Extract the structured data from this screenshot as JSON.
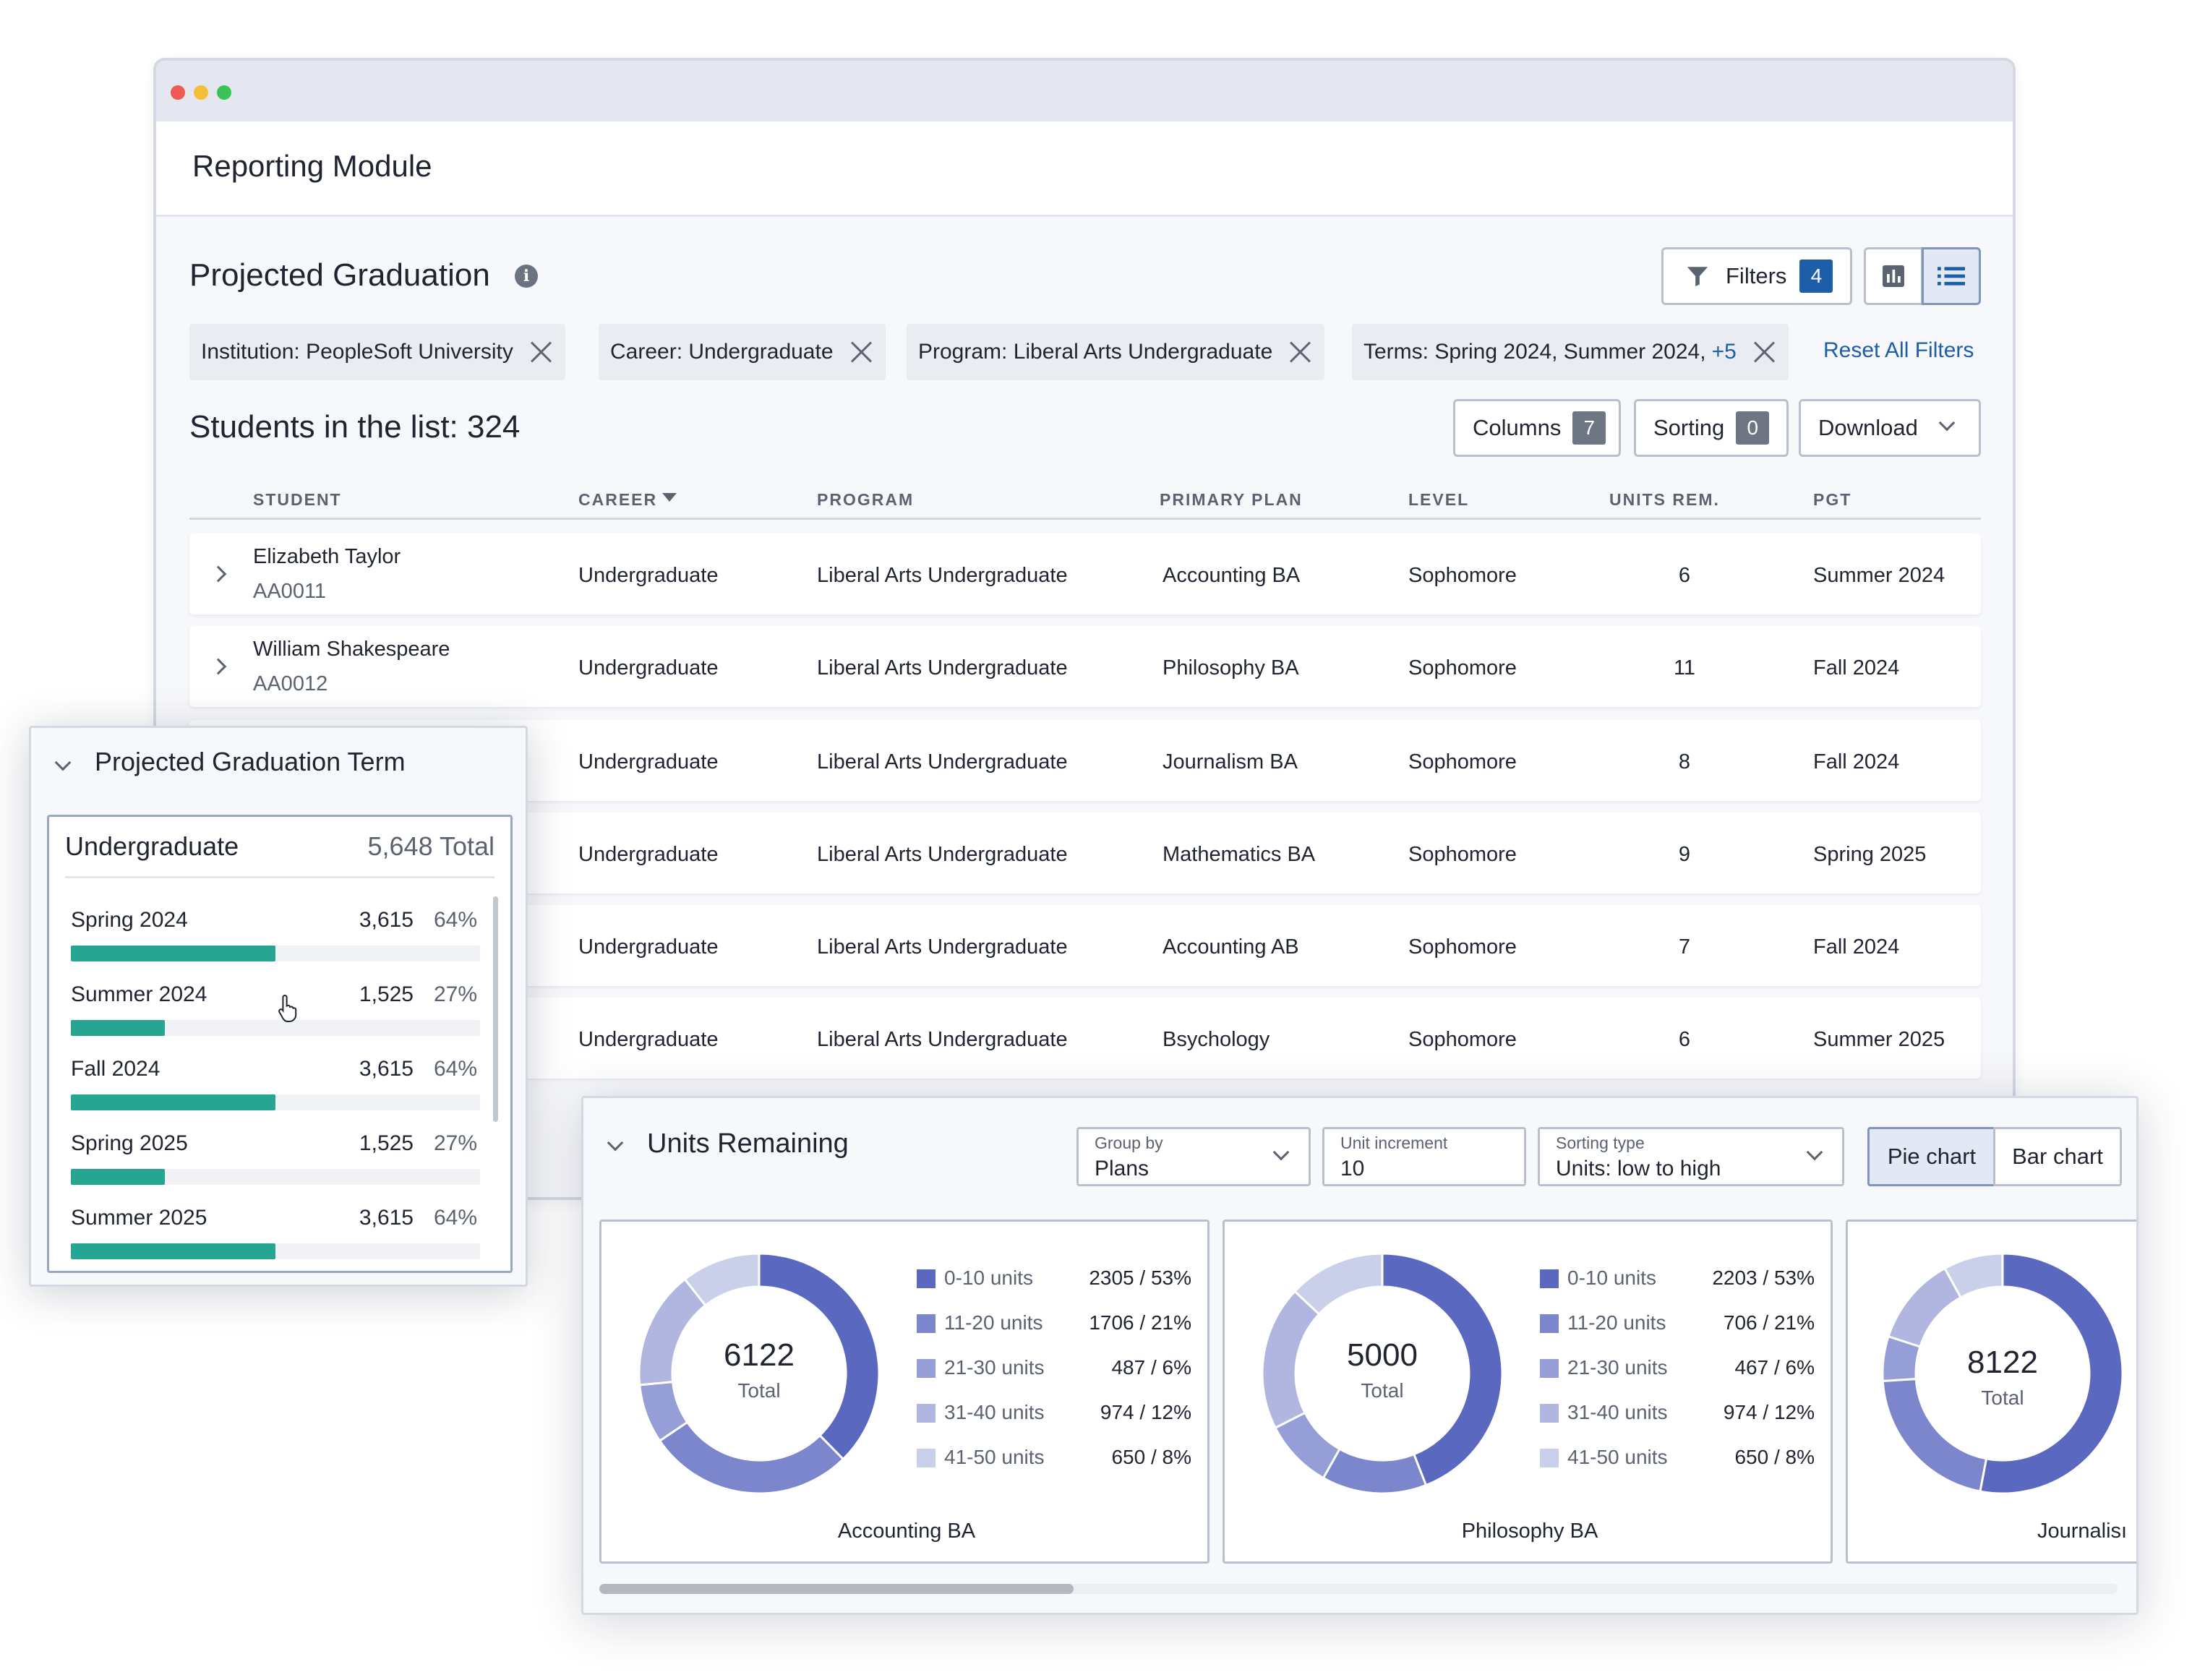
{
  "window": {
    "controls": [
      "#ec5a52",
      "#f4be3a",
      "#3bc35a"
    ],
    "module_title": "Reporting Module"
  },
  "report": {
    "title": "Projected Graduation",
    "filters_label": "Filters",
    "filters_count": "4",
    "chips": [
      {
        "text": "Institution: PeopleSoft University",
        "extra": ""
      },
      {
        "text": "Career: Undergraduate",
        "extra": ""
      },
      {
        "text": "Program: Liberal Arts Undergraduate",
        "extra": ""
      },
      {
        "text": "Terms: Spring 2024, Summer 2024,",
        "extra": "+5"
      }
    ],
    "reset_label": "Reset All Filters",
    "students_label": "Students in the list: 324",
    "columns_label": "Columns",
    "columns_count": "7",
    "sorting_label": "Sorting",
    "sorting_count": "0",
    "download_label": "Download"
  },
  "table": {
    "headers": [
      "STUDENT",
      "CAREER",
      "PROGRAM",
      "PRIMARY PLAN",
      "LEVEL",
      "UNITS REM.",
      "PGT"
    ],
    "rows": [
      {
        "name": "Elizabeth Taylor",
        "id": "AA0011",
        "career": "Undergraduate",
        "program": "Liberal Arts Undergraduate",
        "plan": "Accounting BA",
        "level": "Sophomore",
        "units": "6",
        "pgt": "Summer 2024"
      },
      {
        "name": "William Shakespeare",
        "id": "AA0012",
        "career": "Undergraduate",
        "program": "Liberal Arts Undergraduate",
        "plan": "Philosophy BA",
        "level": "Sophomore",
        "units": "11",
        "pgt": "Fall 2024"
      },
      {
        "name": "",
        "id": "",
        "career": "Undergraduate",
        "program": "Liberal Arts Undergraduate",
        "plan": "Journalism BA",
        "level": "Sophomore",
        "units": "8",
        "pgt": "Fall 2024"
      },
      {
        "name": "",
        "id": "",
        "career": "Undergraduate",
        "program": "Liberal Arts Undergraduate",
        "plan": "Mathematics BA",
        "level": "Sophomore",
        "units": "9",
        "pgt": "Spring 2025"
      },
      {
        "name": "",
        "id": "",
        "career": "Undergraduate",
        "program": "Liberal Arts Undergraduate",
        "plan": "Accounting AB",
        "level": "Sophomore",
        "units": "7",
        "pgt": "Fall 2024"
      },
      {
        "name": "",
        "id": "",
        "career": "Undergraduate",
        "program": "Liberal Arts Undergraduate",
        "plan": "Bsychology",
        "level": "Sophomore",
        "units": "6",
        "pgt": "Summer 2025"
      }
    ]
  },
  "pgt_panel": {
    "title": "Projected Graduation Term",
    "card_title": "Undergraduate",
    "card_total": "5,648 Total",
    "bar_color": "#27a593",
    "terms": [
      {
        "label": "Spring 2024",
        "count": "3,615",
        "pct": "64%",
        "fraction": 0.5
      },
      {
        "label": "Summer 2024",
        "count": "1,525",
        "pct": "27%",
        "fraction": 0.23
      },
      {
        "label": "Fall 2024",
        "count": "3,615",
        "pct": "64%",
        "fraction": 0.5
      },
      {
        "label": "Spring 2025",
        "count": "1,525",
        "pct": "27%",
        "fraction": 0.23
      },
      {
        "label": "Summer 2025",
        "count": "3,615",
        "pct": "64%",
        "fraction": 0.5
      }
    ]
  },
  "units_panel": {
    "title": "Units Remaining",
    "group_by_label": "Group by",
    "group_by_value": "Plans",
    "increment_label": "Unit increment",
    "increment_value": "10",
    "sorting_type_label": "Sorting type",
    "sorting_type_value": "Units: low to high",
    "pie_label": "Pie chart",
    "bar_label": "Bar chart"
  },
  "chart_data": [
    {
      "type": "pie",
      "title": "Accounting BA",
      "center_value": "6122",
      "center_label": "Total",
      "categories": [
        "0-10 units",
        "11-20 units",
        "21-30 units",
        "31-40 units",
        "41-50 units"
      ],
      "values": [
        2305,
        1706,
        487,
        974,
        650
      ],
      "value_labels": [
        "2305 / 53%",
        "1706 / 21%",
        "487 / 6%",
        "974 / 12%",
        "650 / 8%"
      ],
      "colors": [
        "#5b68c0",
        "#7b86cc",
        "#959ed6",
        "#b0b6e0",
        "#cacfea"
      ],
      "legend": "right"
    },
    {
      "type": "pie",
      "title": "Philosophy BA",
      "center_value": "5000",
      "center_label": "Total",
      "categories": [
        "0-10 units",
        "11-20 units",
        "21-30 units",
        "31-40 units",
        "41-50 units"
      ],
      "values": [
        2203,
        706,
        467,
        974,
        650
      ],
      "value_labels": [
        "2203 / 53%",
        "706 / 21%",
        "467 / 6%",
        "974 / 12%",
        "650 / 8%"
      ],
      "colors": [
        "#5b68c0",
        "#7b86cc",
        "#959ed6",
        "#b0b6e0",
        "#cacfea"
      ],
      "legend": "right"
    },
    {
      "type": "pie",
      "title": "Journalisı",
      "center_value": "8122",
      "center_label": "Total",
      "categories": [],
      "values": [
        53,
        21,
        6,
        12,
        8
      ],
      "value_labels": [],
      "colors": [
        "#5b68c0",
        "#7b86cc",
        "#959ed6",
        "#b0b6e0",
        "#cacfea"
      ],
      "legend": "right"
    }
  ]
}
